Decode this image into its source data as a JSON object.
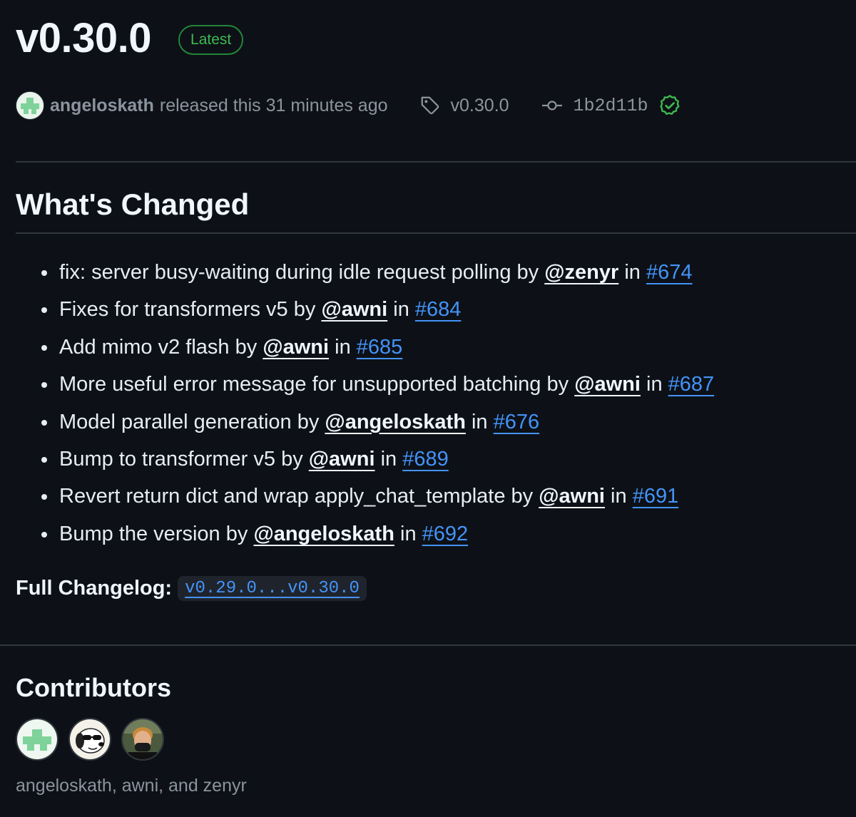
{
  "release": {
    "title": "v0.30.0",
    "badge": "Latest",
    "author": "angeloskath",
    "released_text": "released this 31 minutes ago",
    "tag": "v0.30.0",
    "commit": "1b2d11b"
  },
  "changes": {
    "heading": "What's Changed",
    "by_word": "by",
    "in_word": "in",
    "items": [
      {
        "text": "fix: server busy-waiting during idle request polling",
        "author": "@zenyr",
        "pr": "#674"
      },
      {
        "text": "Fixes for transformers v5",
        "author": "@awni",
        "pr": "#684"
      },
      {
        "text": "Add mimo v2 flash",
        "author": "@awni",
        "pr": "#685"
      },
      {
        "text": "More useful error message for unsupported batching",
        "author": "@awni",
        "pr": "#687"
      },
      {
        "text": "Model parallel generation",
        "author": "@angeloskath",
        "pr": "#676"
      },
      {
        "text": "Bump to transformer v5",
        "author": "@awni",
        "pr": "#689"
      },
      {
        "text": "Revert return dict and wrap apply_chat_template",
        "author": "@awni",
        "pr": "#691"
      },
      {
        "text": "Bump the version",
        "author": "@angeloskath",
        "pr": "#692"
      }
    ],
    "changelog_label": "Full Changelog:",
    "changelog_range": "v0.29.0...v0.30.0"
  },
  "contributors": {
    "heading": "Contributors",
    "names": "angeloskath, awni, and zenyr"
  },
  "colors": {
    "background": "#0d1117",
    "accent_link": "#4493f8",
    "success": "#3fb950",
    "muted": "#8b949e",
    "border": "#30363d"
  },
  "icons": [
    "tag-icon",
    "git-commit-icon",
    "verified-check-icon"
  ]
}
